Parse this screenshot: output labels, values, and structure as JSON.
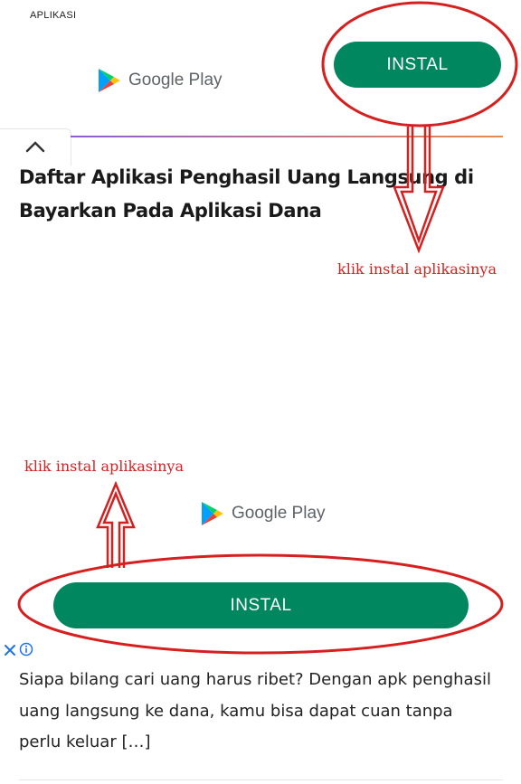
{
  "ad_top": {
    "label": "APLIKASI",
    "store_name": "Google Play",
    "install_label": "INSTAL"
  },
  "article": {
    "headline": "Daftar Aplikasi Penghasil Uang Langsung di Bayarkan Pada Aplikasi Dana",
    "excerpt": "Siapa bilang cari uang harus ribet? Dengan apk penghasil uang langsung ke dana, kamu bisa dapat cuan tanpa perlu keluar […]"
  },
  "annotations": {
    "top": "klik instal aplikasinya",
    "bottom": "klik instal aplikasinya"
  },
  "ad_bottom": {
    "store_name": "Google Play",
    "install_label": "INSTAL"
  },
  "colors": {
    "install_green": "#01875f",
    "annotation_red": "#d61f1f"
  },
  "icons": [
    "google-play-icon",
    "chevron-up-icon",
    "close-icon",
    "info-icon",
    "down-arrow-icon",
    "up-arrow-icon"
  ]
}
